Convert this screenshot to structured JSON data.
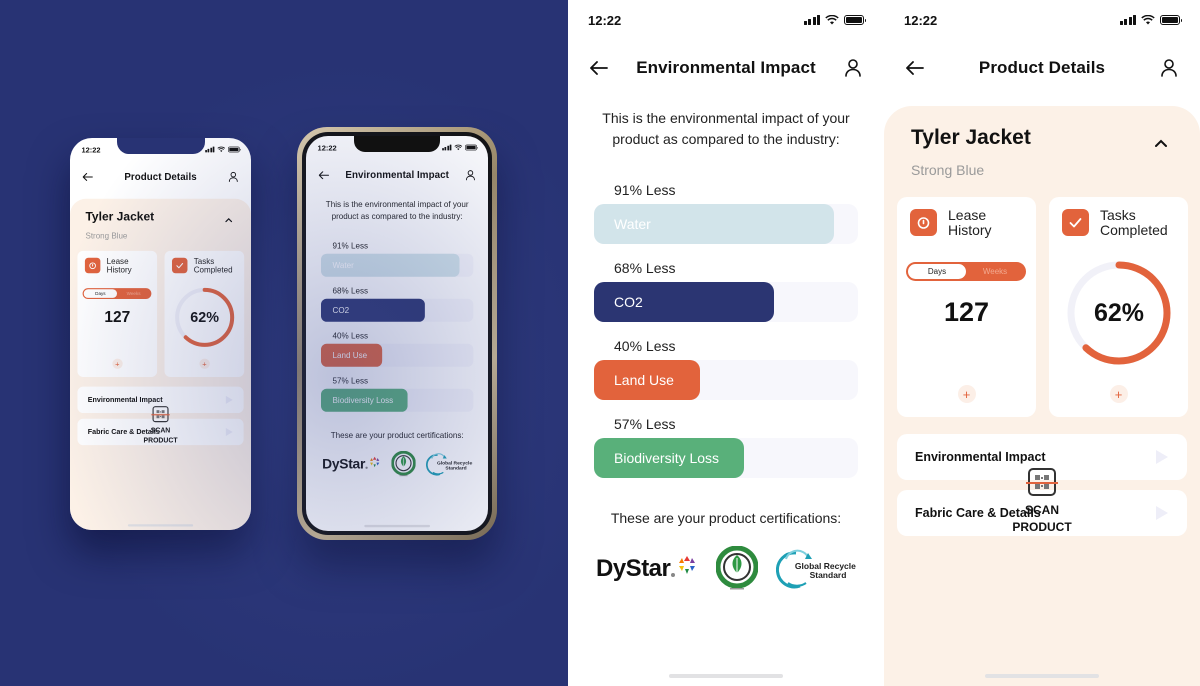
{
  "colors": {
    "background_navy": "#283374",
    "accent_orange": "#e2633c",
    "water": "#d2e4ea",
    "co2": "#2b3572",
    "land_use": "#e2633c",
    "biodiversity": "#59b07a",
    "cream": "#fcf1e7"
  },
  "status_bar": {
    "time": "12:22"
  },
  "environmental_impact": {
    "title": "Environmental Impact",
    "intro": "This is the environmental impact of your product as compared to the industry:",
    "metrics": [
      {
        "caption": "91% Less",
        "label": "Water",
        "percent": 91,
        "color": "#d2e4ea"
      },
      {
        "caption": "68% Less",
        "label": "CO2",
        "percent": 68,
        "color": "#2b3572"
      },
      {
        "caption": "40% Less",
        "label": "Land Use",
        "percent": 40,
        "color": "#e2633c"
      },
      {
        "caption": "57% Less",
        "label": "Biodiversity Loss",
        "percent": 57,
        "color": "#59b07a"
      }
    ],
    "certifications_heading": "These are your product certifications:",
    "certifications": [
      {
        "name": "DyStar"
      },
      {
        "name": "Organic 100 Content Standard"
      },
      {
        "name": "Global Recycled Standard",
        "line1": "Global Recycled",
        "line2": "Standard"
      }
    ]
  },
  "product_details": {
    "title": "Product Details",
    "product_name": "Tyler Jacket",
    "product_color": "Strong Blue",
    "lease": {
      "label_line1": "Lease",
      "label_line2": "History",
      "toggle_options": [
        "Days",
        "Weeks"
      ],
      "selected": "Days",
      "value": "127"
    },
    "tasks": {
      "label_line1": "Tasks",
      "label_line2": "Completed",
      "percent": 62,
      "value_label": "62%"
    },
    "links": [
      "Environmental Impact",
      "Fabric Care & Details"
    ],
    "scan": {
      "line1": "SCAN",
      "line2": "PRODUCT"
    }
  }
}
